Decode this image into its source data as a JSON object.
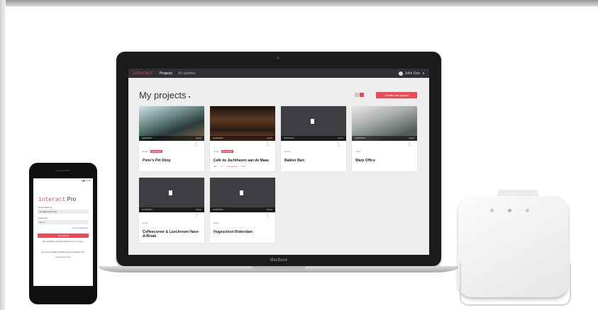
{
  "app": {
    "logo": "interact",
    "nav_tabs": [
      "Projects",
      "All updates"
    ],
    "user_name": "John Doe",
    "page_title": "My projects",
    "new_project_label": "Create new project",
    "laptop_label": "MacBook"
  },
  "projects": [
    {
      "date": "12/06/2017",
      "status": "Active",
      "type": "Retail",
      "badge": "Expanded",
      "name": "Peter's Pet Shop",
      "thumb": "photo-1"
    },
    {
      "date": "12/06/2017",
      "status": "Active",
      "type": "Retail",
      "badge": "Expanded",
      "name": "Café de Jachthaven aan de Maas",
      "thumb": "photo-2",
      "stats": [
        "154",
        "76",
        "4 Integrates",
        "85%"
      ]
    },
    {
      "date": "12/06/2017",
      "status": "Active",
      "type": "Retail",
      "badge": "",
      "name": "Bakker Bart",
      "thumb": "placeholder"
    },
    {
      "date": "12/06/2017",
      "status": "Active",
      "type": "Office",
      "badge": "",
      "name": "Warp Office",
      "thumb": "photo-3"
    },
    {
      "date": "12/06/2017",
      "status": "Active",
      "type": "Retail",
      "badge": "",
      "name": "Coffeecorner & Lunchroom Have-A-Break",
      "thumb": "placeholder"
    },
    {
      "date": "12/06/2017",
      "status": "Active",
      "type": "Retail",
      "badge": "",
      "name": "Hogeschool Rotterdam",
      "thumb": "placeholder"
    }
  ],
  "phone": {
    "status": "▾◢▮ 12:30",
    "logo_a": "interact",
    "logo_b": "Pro",
    "email_label": "Email address",
    "email_value": "user@interact.com",
    "password_label": "Password",
    "password_value": "••••••••",
    "forgot": "Forgot password",
    "login_button": "Get started",
    "terms_prefix": "By proceeding you agree with the",
    "terms_link": "Terms of usage",
    "question": "Are you an installer company and not registered yet?",
    "request": "Request access"
  },
  "colors": {
    "accent": "#e84b5a",
    "nav": "#2e3033",
    "placeholder": "#3c3e42"
  }
}
